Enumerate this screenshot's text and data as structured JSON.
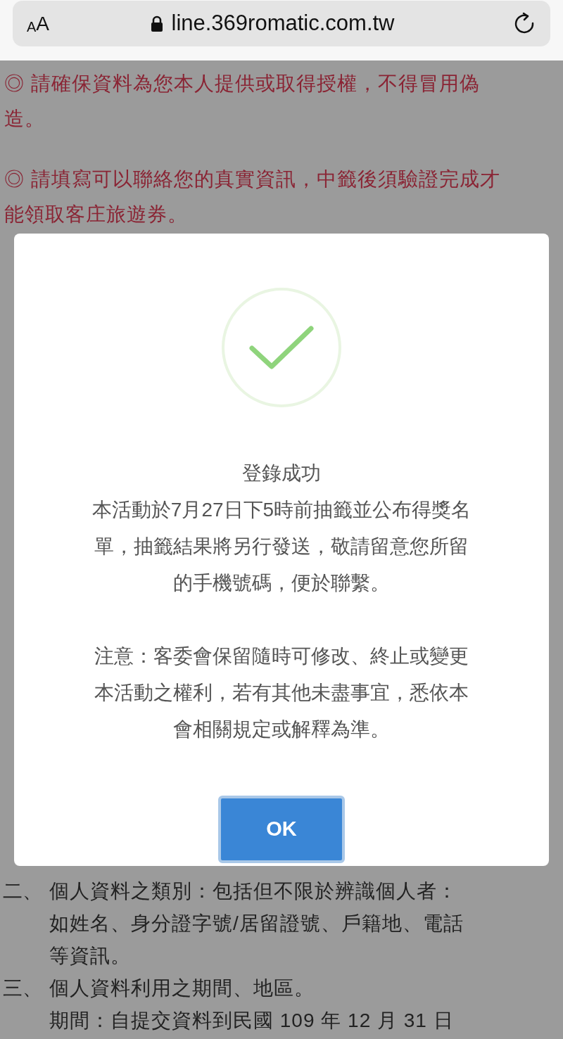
{
  "browser": {
    "text_size_button": "AA",
    "url": "line.369romatic.com.tw"
  },
  "notices": [
    {
      "lines": [
        "◎ 請確保資料為您本人提供或取得授權，不得冒用偽",
        "造。"
      ]
    },
    {
      "lines": [
        "◎ 請填寫可以聯絡您的真實資訊，中籤後須驗證完成才",
        "能領取客庄旅遊券。"
      ]
    }
  ],
  "dialog": {
    "title": "登錄成功",
    "paragraphs": [
      {
        "lines": [
          "本活動於7月27日下5時前抽籤並公布得獎名",
          "單，抽籤結果將另行發送，敬請留意您所留",
          "的手機號碼，便於聯繫。"
        ]
      },
      {
        "lines": [
          "注意：客委會保留隨時可修改、終止或變更",
          "本活動之權利，若有其他未盡事宜，悉依本",
          "會相關規定或解釋為準。"
        ]
      }
    ],
    "button": "OK"
  },
  "terms": [
    {
      "marker": "二、",
      "lines": [
        "個人資料之類別：包括但不限於辨識個人者：",
        "如姓名、身分證字號/居留證號、戶籍地、電話",
        "等資訊。"
      ]
    },
    {
      "marker": "三、",
      "lines": [
        "個人資料利用之期間、地區。",
        "期間：自提交資料到民國 109 年 12 月 31 日"
      ]
    }
  ]
}
